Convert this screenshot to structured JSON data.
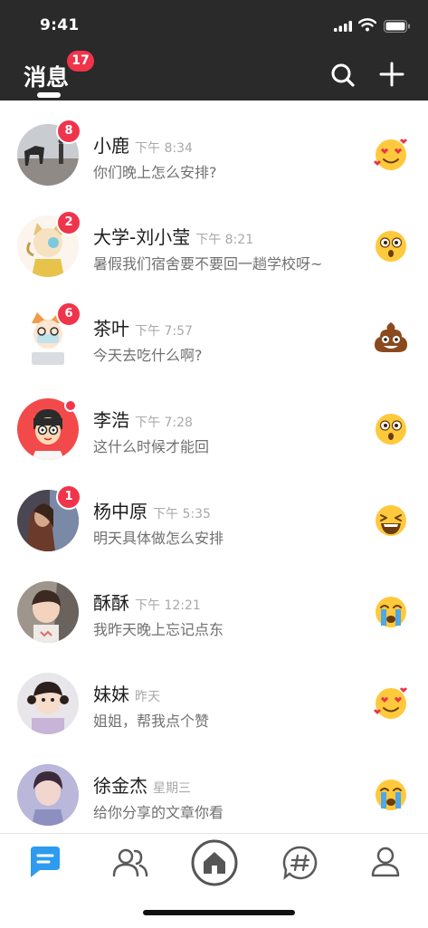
{
  "status_bar": {
    "time": "9:41"
  },
  "header": {
    "title": "消息",
    "unread_badge": "17"
  },
  "conversations": [
    {
      "name": "小鹿",
      "time": "下午 8:34",
      "message": "你们晚上怎么安排?",
      "badge": "8",
      "emoji_icon": "heart-eyes-emoji-icon"
    },
    {
      "name": "大学-刘小莹",
      "time": "下午 8:21",
      "message": "暑假我们宿舍要不要回一趟学校呀~",
      "badge": "2",
      "emoji_icon": "surprised-emoji-icon"
    },
    {
      "name": "茶叶",
      "time": "下午 7:57",
      "message": "今天去吃什么啊?",
      "badge": "6",
      "emoji_icon": "poop-emoji-icon"
    },
    {
      "name": "李浩",
      "time": "下午 7:28",
      "message": "这什么时候才能回",
      "badge": "",
      "emoji_icon": "surprised-emoji-icon"
    },
    {
      "name": "杨中原",
      "time": "下午 5:35",
      "message": "明天具体做怎么安排",
      "badge": "1",
      "emoji_icon": "laughing-emoji-icon"
    },
    {
      "name": "酥酥",
      "time": "下午 12:21",
      "message": "我昨天晚上忘记点东",
      "badge": "",
      "emoji_icon": "crying-emoji-icon"
    },
    {
      "name": "妹妹",
      "time": "昨天",
      "message": "姐姐，帮我点个赞",
      "badge": "",
      "emoji_icon": "heart-eyes-emoji-icon"
    },
    {
      "name": "徐金杰",
      "time": "星期三",
      "message": "给你分享的文章你看",
      "badge": "",
      "emoji_icon": "crying-emoji-icon"
    }
  ],
  "tabbar": {
    "tabs": [
      "message-tab-icon",
      "contacts-tab-icon",
      "home-tab-icon",
      "topic-tab-icon",
      "profile-tab-icon"
    ],
    "active": "message-tab-icon"
  },
  "colors": {
    "header_bg": "#2a2a2a",
    "badge": "#f0344c",
    "accent": "#2c9bf0"
  }
}
